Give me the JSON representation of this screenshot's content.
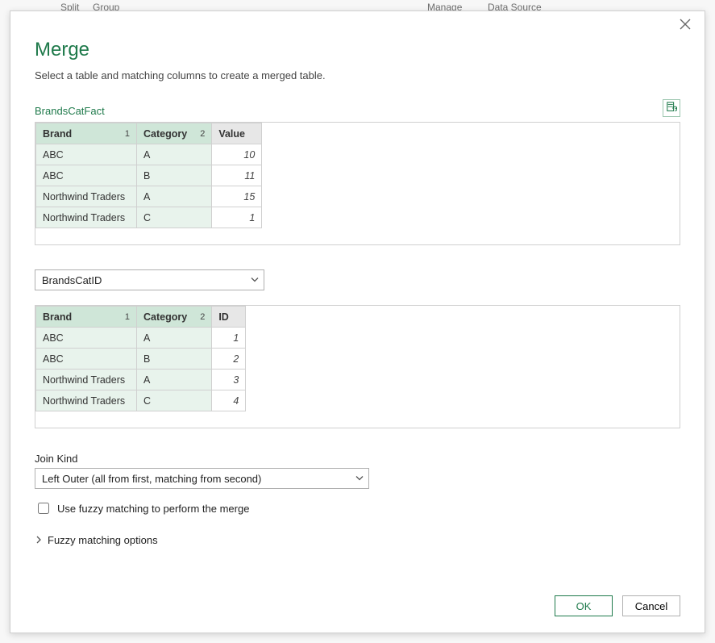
{
  "bg_hints": {
    "left1": "Split",
    "left2": "Group",
    "right1": "Manage",
    "right2": "Data Source"
  },
  "dialog": {
    "title": "Merge",
    "subtitle": "Select a table and matching columns to create a merged table."
  },
  "table1": {
    "name": "BrandsCatFact",
    "columns": {
      "brand": "Brand",
      "category": "Category",
      "value": "Value",
      "ord_brand": "1",
      "ord_cat": "2"
    },
    "rows": [
      {
        "brand": "ABC",
        "category": "A",
        "value": "10"
      },
      {
        "brand": "ABC",
        "category": "B",
        "value": "11"
      },
      {
        "brand": "Northwind Traders",
        "category": "A",
        "value": "15"
      },
      {
        "brand": "Northwind Traders",
        "category": "C",
        "value": "1"
      }
    ]
  },
  "table2": {
    "selected": "BrandsCatID",
    "columns": {
      "brand": "Brand",
      "category": "Category",
      "id": "ID",
      "ord_brand": "1",
      "ord_cat": "2"
    },
    "rows": [
      {
        "brand": "ABC",
        "category": "A",
        "id": "1"
      },
      {
        "brand": "ABC",
        "category": "B",
        "id": "2"
      },
      {
        "brand": "Northwind Traders",
        "category": "A",
        "id": "3"
      },
      {
        "brand": "Northwind Traders",
        "category": "C",
        "id": "4"
      }
    ]
  },
  "joinkind": {
    "label": "Join Kind",
    "selected": "Left Outer (all from first, matching from second)"
  },
  "fuzzy_checkbox_label": "Use fuzzy matching to perform the merge",
  "fuzzy_options_label": "Fuzzy matching options",
  "footer": {
    "ok": "OK",
    "cancel": "Cancel"
  },
  "icons": {
    "close": "close-icon",
    "refresh_table": "refresh-table-icon",
    "chevron_down": "chevron-down-icon",
    "chevron_right": "chevron-right-icon"
  }
}
